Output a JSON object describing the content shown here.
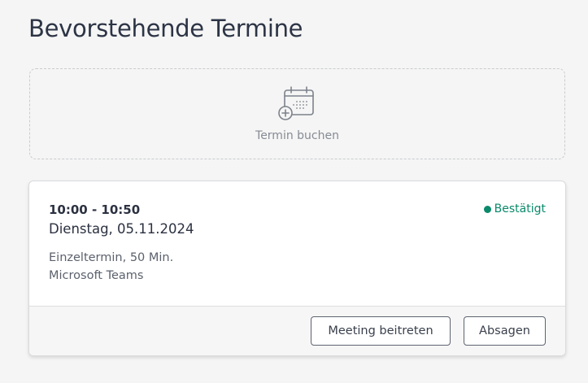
{
  "page": {
    "title": "Bevorstehende Termine"
  },
  "booking": {
    "label": "Termin buchen",
    "icon": "calendar-add-icon"
  },
  "appointment": {
    "time": "10:00 - 10:50",
    "date": "Dienstag, 05.11.2024",
    "type": "Einzeltermin, 50 Min.",
    "location": "Microsoft Teams",
    "status": "Bestätigt",
    "status_color": "#0a8a6b",
    "actions": {
      "join_label": "Meeting beitreten",
      "cancel_label": "Absagen"
    }
  }
}
